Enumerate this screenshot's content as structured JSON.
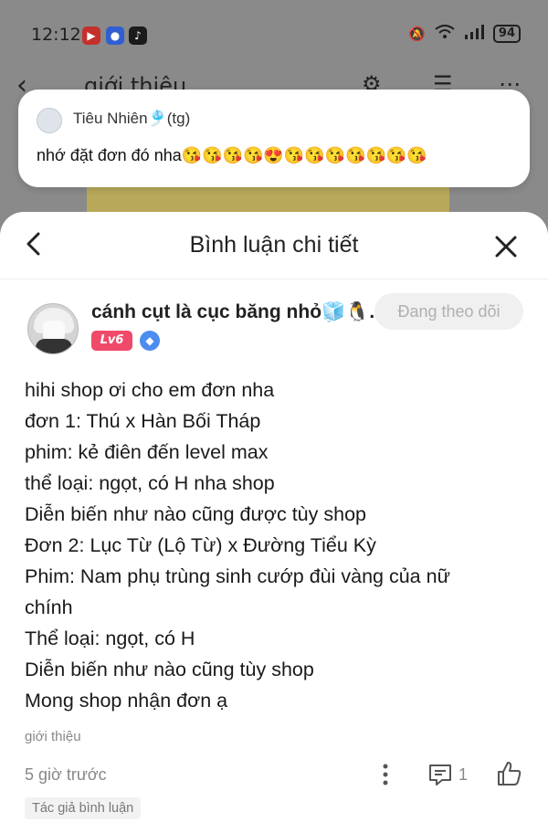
{
  "status_bar": {
    "time": "12:12",
    "battery": "94"
  },
  "background": {
    "title": "giới thiệu"
  },
  "notification": {
    "sender": "Tiêu Nhiên🎐(tg)",
    "message": "nhớ đặt đơn đó nha😘😘😘😘😍😘😘😘😘😘😘😘"
  },
  "sheet": {
    "title": "Bình luận chi tiết"
  },
  "comment": {
    "username": "cánh cụt là cục băng nhỏ🧊🐧...",
    "follow_label": "Đang theo dõi",
    "level": "Lv6",
    "lines": [
      "hihi shop ơi cho em đơn nha",
      "đơn 1: Thú x Hàn Bối Tháp",
      "phim: kẻ điên đến level max",
      "thể loại: ngọt, có H nha shop",
      "Diễn biến như nào cũng được tùy shop",
      "Đơn 2: Lục Từ (Lộ Từ) x Đường Tiểu Kỳ",
      "Phim: Nam phụ trùng sinh cướp đùi vàng của nữ",
      "chính",
      "Thể loại: ngọt, có H",
      "Diễn biến như nào cũng tùy shop",
      "Mong shop nhận đơn ạ"
    ],
    "reference": "giới thiệu",
    "time_ago": "5 giờ trước",
    "reply_count": "1",
    "author_tag": "Tác giả bình luận"
  }
}
